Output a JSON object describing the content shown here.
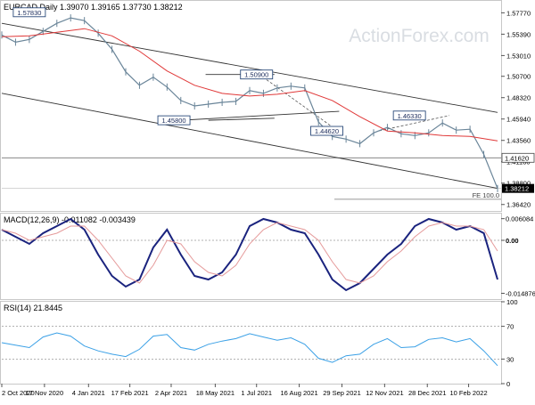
{
  "chart_data": [
    {
      "type": "line",
      "panel": "price",
      "title": "EURCAD,Daily  1.39070 1.39165 1.37730 1.38212",
      "ylim": [
        1.358,
        1.588
      ],
      "y_ticks": [
        "1.57770",
        "1.55390",
        "1.53010",
        "1.50700",
        "1.48320",
        "1.45940",
        "1.43560",
        "1.41180",
        "1.38800",
        "1.36420"
      ],
      "y_tick_values": [
        1.5777,
        1.5539,
        1.5301,
        1.507,
        1.4832,
        1.4594,
        1.4356,
        1.4118,
        1.388,
        1.3642
      ],
      "grid": false,
      "watermark": "ActionForex.com",
      "series": [
        {
          "name": "",
          "role": "price",
          "color": "#6a8599",
          "x": [
            0,
            10,
            20,
            30,
            40,
            50,
            60,
            70,
            80,
            90,
            100,
            110,
            120,
            130,
            140,
            150,
            160,
            170,
            180,
            190,
            200,
            210,
            220,
            230,
            240,
            250,
            260,
            270,
            280,
            290,
            300,
            310,
            320,
            330,
            340,
            350,
            360
          ],
          "values": [
            1.553,
            1.545,
            1.548,
            1.557,
            1.566,
            1.572,
            1.569,
            1.555,
            1.537,
            1.512,
            1.497,
            1.506,
            1.495,
            1.48,
            1.474,
            1.476,
            1.478,
            1.479,
            1.491,
            1.488,
            1.494,
            1.496,
            1.494,
            1.456,
            1.44,
            1.437,
            1.432,
            1.444,
            1.45,
            1.443,
            1.441,
            1.444,
            1.455,
            1.447,
            1.448,
            1.42,
            1.382
          ]
        },
        {
          "name": "",
          "role": "moving-average",
          "color": "#e03838",
          "x": [
            0,
            20,
            40,
            60,
            80,
            100,
            120,
            140,
            160,
            180,
            200,
            220,
            240,
            260,
            280,
            300,
            320,
            340,
            360
          ],
          "values": [
            1.551,
            1.552,
            1.556,
            1.56,
            1.552,
            1.535,
            1.513,
            1.497,
            1.488,
            1.485,
            1.487,
            1.491,
            1.48,
            1.462,
            1.446,
            1.444,
            1.441,
            1.44,
            1.435
          ]
        }
      ],
      "channel_lines": [
        {
          "x": [
            0,
            360
          ],
          "values": [
            1.566,
            1.4667
          ]
        },
        {
          "x": [
            0,
            360
          ],
          "values": [
            1.488,
            1.3822
          ]
        },
        {
          "x": [
            150,
            198
          ],
          "values": [
            1.458,
            1.4603
          ]
        },
        {
          "x": [
            148,
            198
          ],
          "values": [
            1.509,
            1.509
          ]
        },
        {
          "x": [
            130,
            245
          ],
          "values": [
            1.458,
            1.468
          ]
        }
      ],
      "dashed_lines": [
        {
          "x": [
            187,
            244
          ],
          "values": [
            1.509,
            1.4462
          ]
        },
        {
          "x": [
            274,
            325
          ],
          "values": [
            1.4462,
            1.4633
          ]
        }
      ],
      "horizontal_levels": [
        {
          "value": 1.4162,
          "label": "1.41620"
        },
        {
          "value": 1.37,
          "label": "FE 100.0"
        }
      ],
      "current_price": {
        "value": 1.38212,
        "label": "1.38212"
      },
      "annotations": [
        {
          "label": "1.57830",
          "x": 20,
          "value": 1.5783
        },
        {
          "label": "1.50900",
          "x": 185,
          "value": 1.509
        },
        {
          "label": "1.45800",
          "x": 125,
          "value": 1.458
        },
        {
          "label": "1.44620",
          "x": 236,
          "value": 1.4462
        },
        {
          "label": "1.46330",
          "x": 296,
          "value": 1.4633
        }
      ]
    },
    {
      "type": "line",
      "panel": "macd",
      "title": "MACD(12,26,9) -0.011082 -0.003439",
      "ylim": [
        -0.0165,
        0.0075
      ],
      "y_ticks": [
        "0.006084",
        "0.00",
        "-0.014876"
      ],
      "y_tick_values": [
        0.006084,
        0.0,
        -0.014876
      ],
      "series": [
        {
          "name": "",
          "role": "macd",
          "color": "#1a237e",
          "x": [
            0,
            10,
            20,
            30,
            40,
            50,
            60,
            70,
            80,
            90,
            100,
            110,
            120,
            130,
            140,
            150,
            160,
            170,
            180,
            190,
            200,
            210,
            220,
            230,
            240,
            250,
            260,
            270,
            280,
            290,
            300,
            310,
            320,
            330,
            340,
            350,
            360
          ],
          "values": [
            0.003,
            0.001,
            -0.001,
            0.002,
            0.004,
            0.006,
            0.003,
            -0.004,
            -0.01,
            -0.013,
            -0.011,
            -0.002,
            0.003,
            -0.004,
            -0.01,
            -0.011,
            -0.009,
            -0.004,
            0.004,
            0.006,
            0.005,
            0.003,
            0.002,
            -0.004,
            -0.011,
            -0.014,
            -0.012,
            -0.008,
            -0.004,
            -0.001,
            0.004,
            0.006,
            0.005,
            0.003,
            0.004,
            0.002,
            -0.011
          ]
        },
        {
          "name": "",
          "role": "signal",
          "color": "#e59a9a",
          "x": [
            0,
            10,
            20,
            30,
            40,
            50,
            60,
            70,
            80,
            90,
            100,
            110,
            120,
            130,
            140,
            150,
            160,
            170,
            180,
            190,
            200,
            210,
            220,
            230,
            240,
            250,
            260,
            270,
            280,
            290,
            300,
            310,
            320,
            330,
            340,
            350,
            360
          ],
          "values": [
            0.003,
            0.002,
            0.0,
            0.001,
            0.002,
            0.004,
            0.004,
            0.0,
            -0.005,
            -0.01,
            -0.012,
            -0.007,
            0.0,
            -0.001,
            -0.006,
            -0.009,
            -0.01,
            -0.007,
            -0.001,
            0.003,
            0.005,
            0.004,
            0.003,
            0.0,
            -0.006,
            -0.011,
            -0.012,
            -0.01,
            -0.006,
            -0.003,
            0.001,
            0.004,
            0.005,
            0.004,
            0.004,
            0.003,
            -0.003
          ]
        }
      ]
    },
    {
      "type": "line",
      "panel": "rsi",
      "title": "RSI(14) 21.8445",
      "ylim": [
        0,
        100
      ],
      "y_ticks": [
        "100",
        "70",
        "30",
        "0"
      ],
      "y_tick_values": [
        100,
        70,
        30,
        0
      ],
      "reference_levels": [
        70,
        30
      ],
      "series": [
        {
          "name": "",
          "role": "rsi",
          "color": "#3aa0e6",
          "x": [
            0,
            10,
            20,
            30,
            40,
            50,
            60,
            70,
            80,
            90,
            100,
            110,
            120,
            130,
            140,
            150,
            160,
            170,
            180,
            190,
            200,
            210,
            220,
            230,
            240,
            250,
            260,
            270,
            280,
            290,
            300,
            310,
            320,
            330,
            340,
            350,
            360
          ],
          "values": [
            50,
            47,
            44,
            57,
            62,
            58,
            46,
            40,
            36,
            33,
            42,
            58,
            60,
            44,
            41,
            48,
            52,
            55,
            61,
            57,
            53,
            56,
            48,
            31,
            26,
            34,
            36,
            48,
            55,
            44,
            45,
            54,
            56,
            51,
            55,
            40,
            22
          ]
        }
      ],
      "x_tick_labels": [
        "2 Oct 2020",
        "17 Nov 2020",
        "4 Jan 2021",
        "17 Feb 2021",
        "2 Apr 2021",
        "18 May 2021",
        "1 Jul 2021",
        "16 Aug 2021",
        "29 Sep 2021",
        "12 Nov 2021",
        "28 Dec 2021",
        "10 Feb 2022"
      ],
      "x_tick_positions": [
        0,
        31,
        63,
        93,
        123,
        155,
        185,
        216,
        247,
        278,
        309,
        339
      ]
    }
  ]
}
